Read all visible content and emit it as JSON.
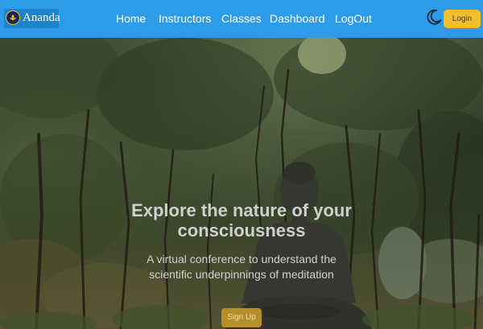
{
  "brand": {
    "name": "Ananda",
    "logo_icon": "lotus-logo-icon"
  },
  "nav": {
    "links": [
      "Home",
      "Instructors",
      "Classes",
      "Dashboard",
      "LogOut"
    ],
    "theme_icon": "moon-icon",
    "login_label": "Login"
  },
  "hero": {
    "title": "Explore the nature of your consciousness",
    "subtitle": "A virtual conference to understand the scientific underpinnings of meditation",
    "signup_label": "Sign Up",
    "background": "forest with meditating buddha statue"
  },
  "colors": {
    "navbar": "#2d9ce8",
    "login_button": "#f3bf2f",
    "signup_button": "#b58f28"
  }
}
